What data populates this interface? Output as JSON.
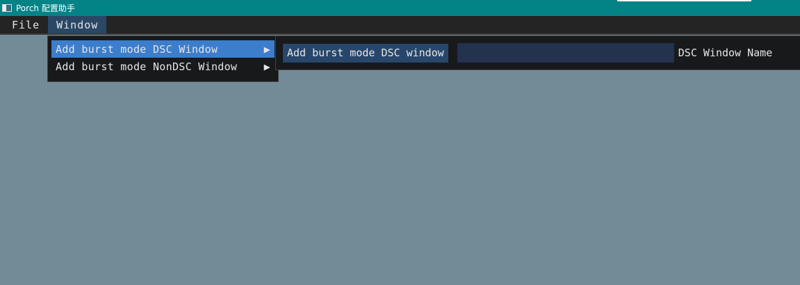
{
  "title": "Porch 配置助手",
  "menus": [
    "File",
    "Window"
  ],
  "window_menu": {
    "items": [
      {
        "label": "Add burst mode DSC Window",
        "arrow": "▶"
      },
      {
        "label": "Add burst mode NonDSC Window",
        "arrow": "▶"
      }
    ]
  },
  "submenu": {
    "button": "Add burst mode DSC window",
    "input_value": "",
    "input_label": "DSC Window Name"
  }
}
